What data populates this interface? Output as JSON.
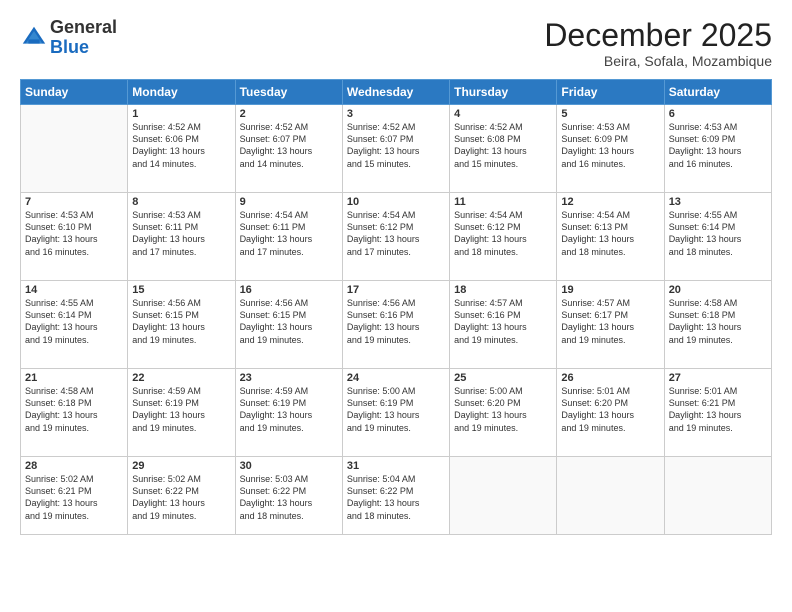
{
  "logo": {
    "general": "General",
    "blue": "Blue"
  },
  "header": {
    "title": "December 2025",
    "subtitle": "Beira, Sofala, Mozambique"
  },
  "columns": [
    "Sunday",
    "Monday",
    "Tuesday",
    "Wednesday",
    "Thursday",
    "Friday",
    "Saturday"
  ],
  "weeks": [
    [
      {
        "day": "",
        "info": ""
      },
      {
        "day": "1",
        "info": "Sunrise: 4:52 AM\nSunset: 6:06 PM\nDaylight: 13 hours\nand 14 minutes."
      },
      {
        "day": "2",
        "info": "Sunrise: 4:52 AM\nSunset: 6:07 PM\nDaylight: 13 hours\nand 14 minutes."
      },
      {
        "day": "3",
        "info": "Sunrise: 4:52 AM\nSunset: 6:07 PM\nDaylight: 13 hours\nand 15 minutes."
      },
      {
        "day": "4",
        "info": "Sunrise: 4:52 AM\nSunset: 6:08 PM\nDaylight: 13 hours\nand 15 minutes."
      },
      {
        "day": "5",
        "info": "Sunrise: 4:53 AM\nSunset: 6:09 PM\nDaylight: 13 hours\nand 16 minutes."
      },
      {
        "day": "6",
        "info": "Sunrise: 4:53 AM\nSunset: 6:09 PM\nDaylight: 13 hours\nand 16 minutes."
      }
    ],
    [
      {
        "day": "7",
        "info": "Sunrise: 4:53 AM\nSunset: 6:10 PM\nDaylight: 13 hours\nand 16 minutes."
      },
      {
        "day": "8",
        "info": "Sunrise: 4:53 AM\nSunset: 6:11 PM\nDaylight: 13 hours\nand 17 minutes."
      },
      {
        "day": "9",
        "info": "Sunrise: 4:54 AM\nSunset: 6:11 PM\nDaylight: 13 hours\nand 17 minutes."
      },
      {
        "day": "10",
        "info": "Sunrise: 4:54 AM\nSunset: 6:12 PM\nDaylight: 13 hours\nand 17 minutes."
      },
      {
        "day": "11",
        "info": "Sunrise: 4:54 AM\nSunset: 6:12 PM\nDaylight: 13 hours\nand 18 minutes."
      },
      {
        "day": "12",
        "info": "Sunrise: 4:54 AM\nSunset: 6:13 PM\nDaylight: 13 hours\nand 18 minutes."
      },
      {
        "day": "13",
        "info": "Sunrise: 4:55 AM\nSunset: 6:14 PM\nDaylight: 13 hours\nand 18 minutes."
      }
    ],
    [
      {
        "day": "14",
        "info": "Sunrise: 4:55 AM\nSunset: 6:14 PM\nDaylight: 13 hours\nand 19 minutes."
      },
      {
        "day": "15",
        "info": "Sunrise: 4:56 AM\nSunset: 6:15 PM\nDaylight: 13 hours\nand 19 minutes."
      },
      {
        "day": "16",
        "info": "Sunrise: 4:56 AM\nSunset: 6:15 PM\nDaylight: 13 hours\nand 19 minutes."
      },
      {
        "day": "17",
        "info": "Sunrise: 4:56 AM\nSunset: 6:16 PM\nDaylight: 13 hours\nand 19 minutes."
      },
      {
        "day": "18",
        "info": "Sunrise: 4:57 AM\nSunset: 6:16 PM\nDaylight: 13 hours\nand 19 minutes."
      },
      {
        "day": "19",
        "info": "Sunrise: 4:57 AM\nSunset: 6:17 PM\nDaylight: 13 hours\nand 19 minutes."
      },
      {
        "day": "20",
        "info": "Sunrise: 4:58 AM\nSunset: 6:18 PM\nDaylight: 13 hours\nand 19 minutes."
      }
    ],
    [
      {
        "day": "21",
        "info": "Sunrise: 4:58 AM\nSunset: 6:18 PM\nDaylight: 13 hours\nand 19 minutes."
      },
      {
        "day": "22",
        "info": "Sunrise: 4:59 AM\nSunset: 6:19 PM\nDaylight: 13 hours\nand 19 minutes."
      },
      {
        "day": "23",
        "info": "Sunrise: 4:59 AM\nSunset: 6:19 PM\nDaylight: 13 hours\nand 19 minutes."
      },
      {
        "day": "24",
        "info": "Sunrise: 5:00 AM\nSunset: 6:19 PM\nDaylight: 13 hours\nand 19 minutes."
      },
      {
        "day": "25",
        "info": "Sunrise: 5:00 AM\nSunset: 6:20 PM\nDaylight: 13 hours\nand 19 minutes."
      },
      {
        "day": "26",
        "info": "Sunrise: 5:01 AM\nSunset: 6:20 PM\nDaylight: 13 hours\nand 19 minutes."
      },
      {
        "day": "27",
        "info": "Sunrise: 5:01 AM\nSunset: 6:21 PM\nDaylight: 13 hours\nand 19 minutes."
      }
    ],
    [
      {
        "day": "28",
        "info": "Sunrise: 5:02 AM\nSunset: 6:21 PM\nDaylight: 13 hours\nand 19 minutes."
      },
      {
        "day": "29",
        "info": "Sunrise: 5:02 AM\nSunset: 6:22 PM\nDaylight: 13 hours\nand 19 minutes."
      },
      {
        "day": "30",
        "info": "Sunrise: 5:03 AM\nSunset: 6:22 PM\nDaylight: 13 hours\nand 18 minutes."
      },
      {
        "day": "31",
        "info": "Sunrise: 5:04 AM\nSunset: 6:22 PM\nDaylight: 13 hours\nand 18 minutes."
      },
      {
        "day": "",
        "info": ""
      },
      {
        "day": "",
        "info": ""
      },
      {
        "day": "",
        "info": ""
      }
    ]
  ]
}
